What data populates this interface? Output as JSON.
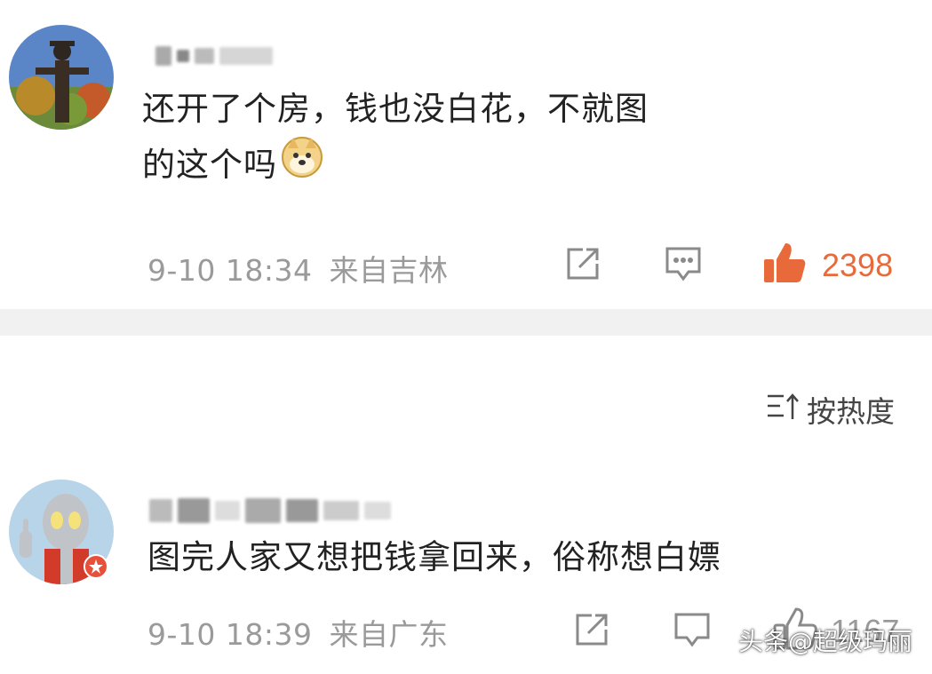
{
  "comments": [
    {
      "text_line1": "还开了个房，钱也没白花，不就图",
      "text_line2": "的这个吗",
      "emoji": "doge-emoji",
      "time": "9-10 18:34",
      "location": "来自吉林",
      "likes": "2398",
      "liked": true
    },
    {
      "text_line1": "图完人家又想把钱拿回来，俗称想白嫖",
      "time": "9-10 18:39",
      "location": "来自广东",
      "likes": "1167",
      "liked": false
    }
  ],
  "sort_label": "按热度",
  "watermark": "头条@超级玛丽",
  "colors": {
    "accent": "#e86a3a",
    "meta": "#9a9a9a",
    "divider": "#f1f1f1"
  }
}
